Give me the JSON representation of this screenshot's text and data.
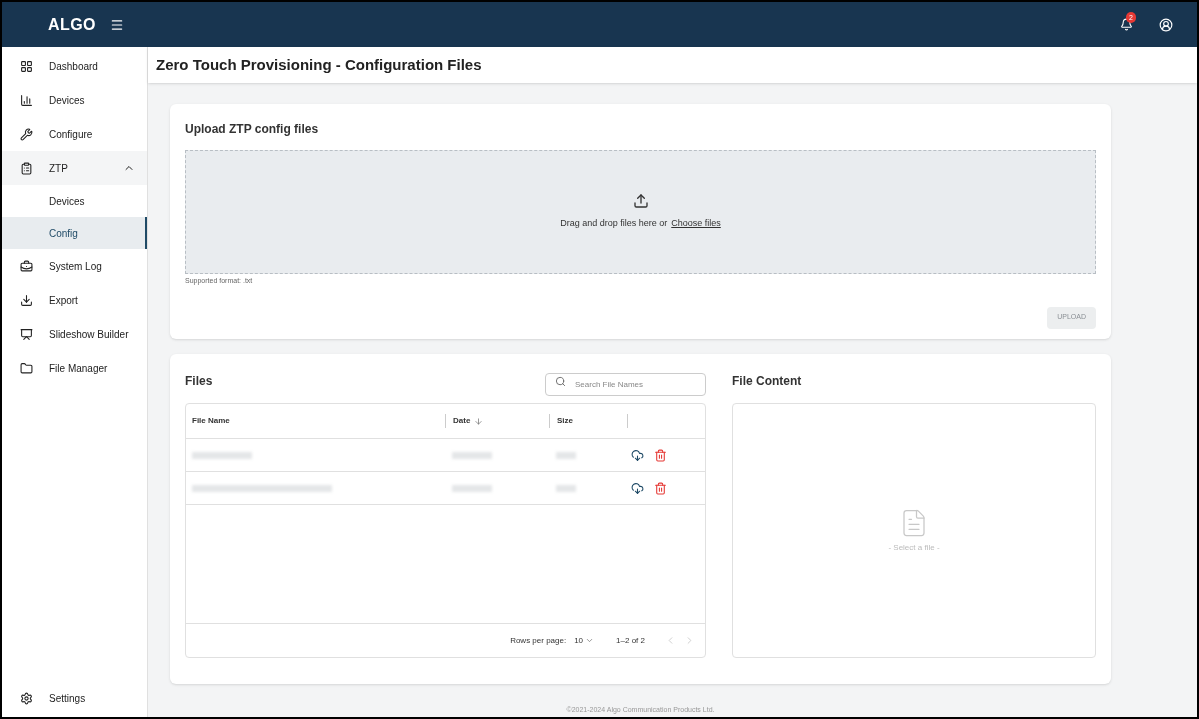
{
  "header": {
    "logo": "ALGO",
    "notification_count": "2"
  },
  "sidebar": {
    "items": [
      {
        "kind": "link",
        "label": "Dashboard",
        "selected": false
      },
      {
        "kind": "link",
        "label": "Devices",
        "selected": false
      },
      {
        "kind": "link",
        "label": "Configure",
        "selected": false
      },
      {
        "kind": "group",
        "label": "ZTP",
        "selected": false,
        "expanded": true,
        "children": [
          {
            "label": "Devices",
            "selected": false
          },
          {
            "label": "Config",
            "selected": true
          }
        ]
      },
      {
        "kind": "link",
        "label": "System Log",
        "selected": false
      },
      {
        "kind": "link",
        "label": "Export",
        "selected": false
      },
      {
        "kind": "link",
        "label": "Slideshow Builder",
        "selected": false
      },
      {
        "kind": "link",
        "label": "File Manager",
        "selected": false
      }
    ],
    "footer_item": {
      "label": "Settings"
    }
  },
  "page_title": "Zero Touch Provisioning - Configuration Files",
  "upload_card": {
    "title": "Upload ZTP config files",
    "drop_text": "Drag and drop files here or",
    "choose_link": "Choose files",
    "hint": "Supported format: .txt",
    "upload_button": {
      "label": "UPLOAD",
      "disabled": true
    }
  },
  "files": {
    "title": "Files",
    "search": {
      "placeholder": "Search File Names"
    },
    "columns": [
      {
        "label": "File Name",
        "sorted": false
      },
      {
        "label": "Date",
        "sorted": true
      },
      {
        "label": "Size",
        "sorted": false
      }
    ],
    "rows": [
      {
        "redacted": true
      },
      {
        "redacted": true
      }
    ],
    "pagination": {
      "rows_per_page_label": "Rows per page:",
      "rows_per_page": "10",
      "range": "1–2 of 2",
      "prev_disabled": true,
      "next_disabled": true
    }
  },
  "file_content": {
    "title": "File Content",
    "empty_text": "- Select a file -"
  },
  "footer": "©2021-2024 Algo Communication Products Ltd."
}
